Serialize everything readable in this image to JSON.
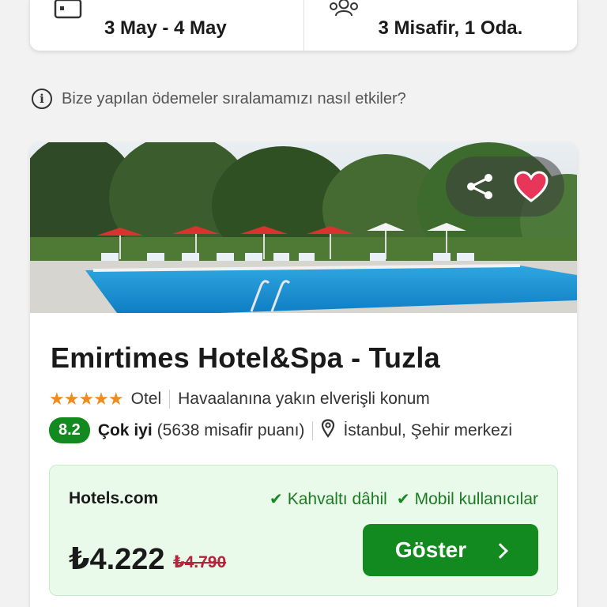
{
  "search": {
    "dates": "3 May - 4 May",
    "guests": "3 Misafir, 1 Oda."
  },
  "info": {
    "text": "Bize yapılan ödemeler sıralamamızı nasıl etkiler?"
  },
  "hotel": {
    "name": "Emirtimes Hotel&Spa - Tuzla",
    "stars": "★★★★★",
    "type": "Otel",
    "highlight": "Havaalanına yakın elverişli konum",
    "score": "8.2",
    "rating_word": "Çok iyi",
    "review_count": "(5638 misafir puanı)",
    "location": "İstanbul, Şehir merkezi"
  },
  "offer": {
    "provider": "Hotels.com",
    "features": [
      "Kahvaltı dâhil",
      "Mobil kullanıcılar"
    ],
    "price": "₺4.222",
    "old_price": "₺4.790",
    "cta": "Göster"
  },
  "colors": {
    "accent_green": "#138a1f",
    "star_orange": "#f08c1c",
    "heart_red": "#e8365a",
    "old_price_red": "#b5233d",
    "offer_bg": "#eafaea"
  },
  "icons": {
    "calendar": "calendar-icon",
    "guests": "guests-icon",
    "info": "info-icon",
    "share": "share-icon",
    "heart": "heart-icon",
    "pin": "location-pin-icon",
    "check": "check-icon",
    "chevron": "chevron-right-icon"
  }
}
